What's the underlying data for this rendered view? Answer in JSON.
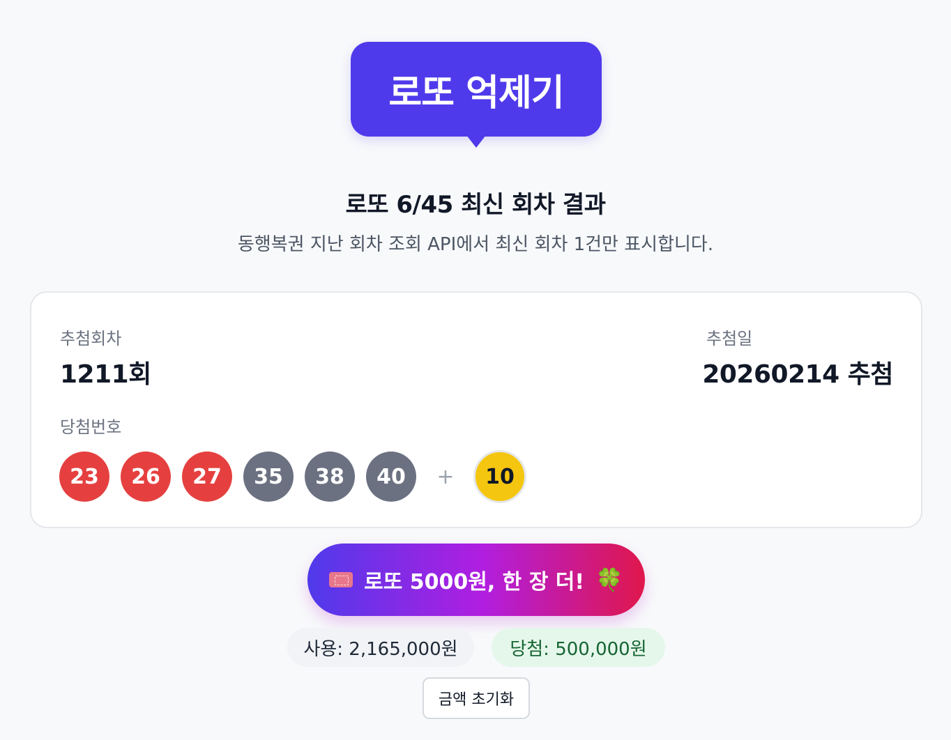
{
  "header": {
    "title": "로또 억제기"
  },
  "intro": {
    "subtitle": "로또 6/45 최신 회차 결과",
    "description": "동행복권 지난 회차 조회 API에서 최신 회차 1건만 표시합니다."
  },
  "result": {
    "round_label": "추첨회차",
    "round_value": "1211회",
    "date_label": "추첨일",
    "date_value": "20260214 추첨",
    "numbers_label": "당첨번호",
    "numbers": [
      "23",
      "26",
      "27",
      "35",
      "38",
      "40"
    ],
    "plus": "+",
    "bonus": "10"
  },
  "ball_colors": {
    "red": "#e5403f",
    "gray": "#6b7181",
    "bonus": "#f5c60f"
  },
  "cta": {
    "icon": "ticket-icon",
    "label": "로또 5000원, 한 장 더!",
    "trail_icon": "four-leaf-clover-icon",
    "trail_glyph": "🍀"
  },
  "stats": {
    "used": "사용: 2,165,000원",
    "won": "당첨: 500,000원"
  },
  "reset_label": "금액 초기화"
}
